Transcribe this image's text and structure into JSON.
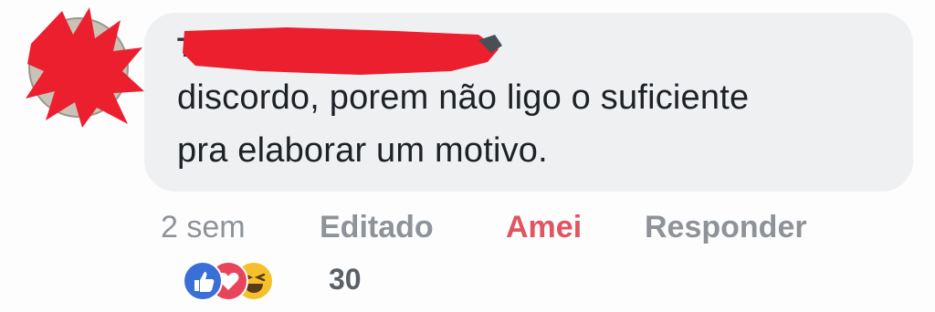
{
  "comment": {
    "author_initial": "T",
    "text_line1": "discordo, porem não ligo o suficiente",
    "text_line2": "pra elaborar um motivo."
  },
  "actions": {
    "time": "2 sem",
    "edited": "Editado",
    "reaction_label": "Amei",
    "reply": "Responder"
  },
  "reactions": {
    "icons": [
      "like-icon",
      "love-icon",
      "haha-icon"
    ],
    "count": "30"
  },
  "colors": {
    "bubble": "#eef0f2",
    "text": "#1e2226",
    "muted": "#8e9399",
    "love": "#e05560",
    "like": "#3b6fd8",
    "redaction": "#ec1f2e"
  }
}
